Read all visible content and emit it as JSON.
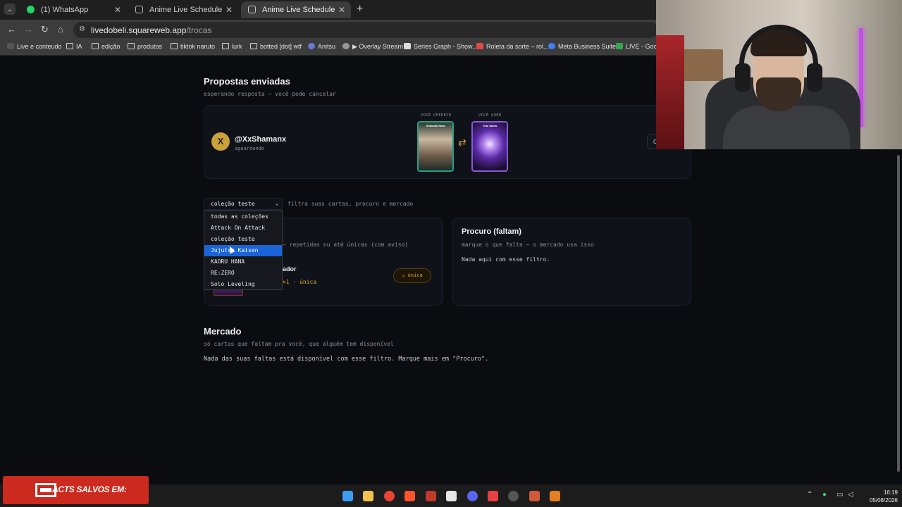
{
  "browser": {
    "tabs": [
      {
        "label": "(1) WhatsApp",
        "active": false
      },
      {
        "label": "Anime Live Schedule",
        "active": false
      },
      {
        "label": "Anime Live Schedule",
        "active": true
      }
    ],
    "url_host": "livedobeli.squareweb.app",
    "url_path": "/trocas",
    "bookmarks": [
      "Live e conteudo",
      "IA",
      "edição",
      "produtos",
      "tiktok naruto",
      "lurk",
      "botted [dot] wtf",
      "Anitsu",
      "▶ Overlay Stream",
      "Series Graph - Show...",
      "Roleta da sorte – rol...",
      "Meta Business Suite",
      "LIVE - Goog"
    ]
  },
  "sent": {
    "title": "Propostas enviadas",
    "subtitle": "esperando resposta — você pode cancelar",
    "proposal": {
      "avatar_letter": "X",
      "user": "@XxShamanx",
      "status": "aguardando",
      "offer_label": "VOCÊ OFERECE",
      "want_label": "VOCÊ QUER",
      "offer_card_title": "Shikadai Nara",
      "want_card_title": "Yuki Sama",
      "cancel_label": "Car"
    }
  },
  "filter": {
    "selected": "coleção teste",
    "hint": "filtra suas cartas, procuro e mercado",
    "options": [
      "todas as coleções",
      "Attack On Attack",
      "coleção teste",
      "Jujutsu Kaisen",
      "KAORU HANA",
      "RE:ZERO",
      "Solo Leveling"
    ],
    "highlighted_index": 3
  },
  "repeated": {
    "subtitle_frag": "— repetidas ou até únicas (com aviso)",
    "card_name_frag": "ador",
    "card_meta_frag": "×1 · única",
    "badge": "⚠ única"
  },
  "wanted": {
    "title": "Procuro (faltam)",
    "subtitle": "marque o que falta — o mercado usa isso",
    "empty": "Nada aqui com esse filtro."
  },
  "market": {
    "title": "Mercado",
    "subtitle": "só cartas que faltam pra você, que alguém tem disponível",
    "empty": "Nada das suas faltas está disponível com esse filtro. Marque mais em \"Procuro\"."
  },
  "banner": {
    "text": "ACTS SALVOS EM:"
  },
  "taskbar": {
    "time": "16:19",
    "date": "05/08/2026"
  }
}
